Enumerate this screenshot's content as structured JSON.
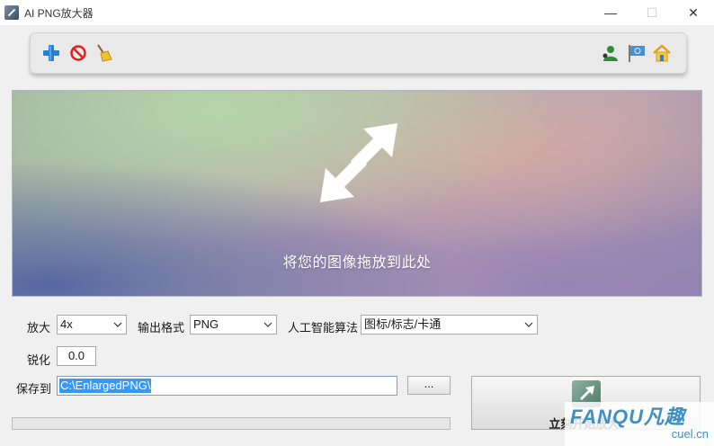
{
  "window": {
    "title": "AI PNG放大器",
    "minimize": "—",
    "maximize": "☐",
    "close": "✕"
  },
  "toolbar": {
    "left_icons": [
      "add-icon",
      "remove-icon",
      "clear-broom-icon"
    ],
    "right_icons": [
      "user-support-icon",
      "flag-icon",
      "home-icon"
    ]
  },
  "dropzone": {
    "hint": "将您的图像拖放到此处",
    "icon": "expand-arrows-icon"
  },
  "settings": {
    "scale_label": "放大",
    "scale_value": "4x",
    "format_label": "输出格式",
    "format_value": "PNG",
    "algorithm_label": "人工智能算法",
    "algorithm_value": "图标/标志/卡通",
    "sharpen_label": "锐化",
    "sharpen_value": "0.0",
    "save_label": "保存到",
    "save_path": "C:\\EnlargedPNG\\",
    "browse_label": "..."
  },
  "progress": {
    "value": 0
  },
  "start": {
    "label": "立刻开始放大!",
    "icon": "enlarge-arrow-icon"
  },
  "watermark": {
    "main": "FANQU凡趣",
    "sub": "cuel.cn"
  },
  "colors": {
    "selection": "#3399ff",
    "watermark": "#3f8fbf"
  }
}
